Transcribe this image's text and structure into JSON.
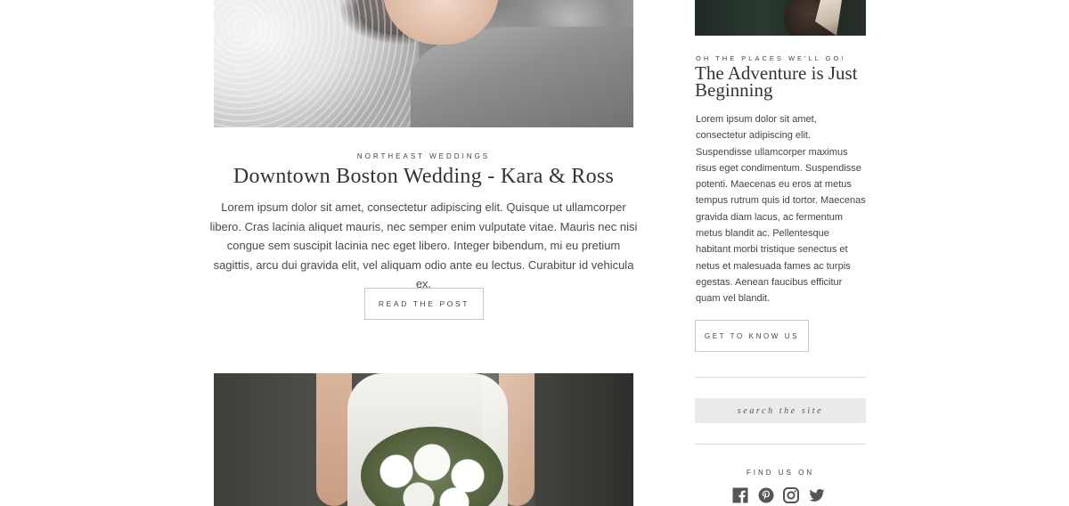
{
  "main": {
    "post": {
      "category": "NORTHEAST WEDDINGS",
      "title": "Downtown Boston Wedding - Kara & Ross",
      "excerpt": "Lorem ipsum dolor sit amet, consectetur adipiscing elit. Quisque ut ullamcorper libero. Cras lacinia aliquet mauris, nec semper enim vulputate vitae. Mauris nec nisi congue sem suscipit lacinia nec eget libero. Integer bibendum, mi eu pretium sagittis, arcu dui gravida elit, vel aliquam odio ante eu lectus. Curabitur id vehicula ex.",
      "read_button_label": "READ THE POST"
    }
  },
  "sidebar": {
    "eyebrow": "OH THE PLACES WE'LL GO!",
    "title": "The Adventure is Just Beginning",
    "body": "Lorem ipsum dolor sit amet, consectetur adipiscing elit. Suspendisse ullamcorper maximus risus eget condimentum. Suspendisse potenti. Maecenas eu eros at metus tempus rutrum quis id tortor. Maecenas gravida diam lacus, ac fermentum metus blandit ac. Pellentesque habitant morbi tristique senectus et netus et malesuada fames ac turpis egestas. Aenean faucibus efficitur quam vel blandit.",
    "button_label": "GET TO KNOW US",
    "search_placeholder": "search the site",
    "find_us_label": "FIND US ON",
    "social_icons": [
      "facebook-icon",
      "pinterest-icon",
      "instagram-icon",
      "twitter-icon"
    ]
  },
  "colors": {
    "icon": "#555555",
    "search_bg": "#e9ebea",
    "divider": "#dcdcdc"
  }
}
